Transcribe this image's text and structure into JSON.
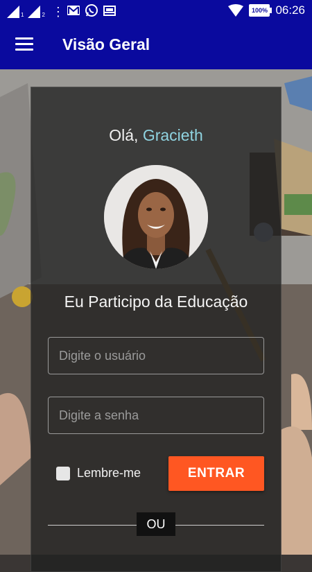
{
  "status_bar": {
    "time": "06:26",
    "battery": "100%",
    "sim1_label": "1",
    "sim2_label": "2",
    "notification_icons": [
      "gmail-icon",
      "whatsapp-icon",
      "inbox-icon"
    ],
    "overflow_label": "⋮"
  },
  "app_bar": {
    "title": "Visão Geral",
    "menu_icon": "menu-icon",
    "color": "#0a0a9e"
  },
  "login": {
    "greeting_prefix": "Olá, ",
    "username": "Gracieth",
    "subtitle": "Eu Participo da Educação",
    "user_placeholder": "Digite o usuário",
    "user_value": "",
    "password_placeholder": "Digite a senha",
    "password_value": "",
    "remember_label": "Lembre-me",
    "remember_checked": false,
    "enter_label": "ENTRAR",
    "or_label": "OU"
  },
  "colors": {
    "accent": "#ff5722",
    "username": "#8fd3e0",
    "card": "rgba(32,32,32,0.78)"
  }
}
